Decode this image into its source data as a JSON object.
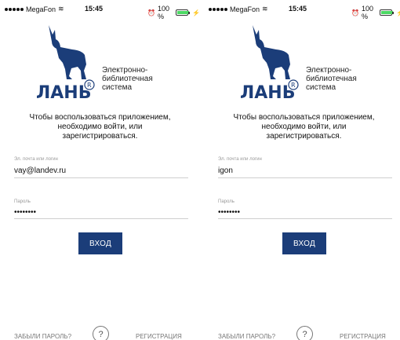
{
  "status": {
    "carrier": "MegaFon",
    "time": "15:45",
    "battery": "100 %",
    "battery_level": 1.0
  },
  "logo": {
    "brand": "ЛАНЬ",
    "tagline": [
      "Электронно-",
      "библиотечная",
      "система"
    ],
    "brand_color": "#1b3d79"
  },
  "intro": [
    "Чтобы воспользоваться приложением,",
    "необходимо войти, или",
    "зарегистрироваться."
  ],
  "screens": [
    {
      "email_label": "Эл. почта или логин",
      "email_value": "vay@landev.ru",
      "password_label": "Пароль",
      "password_value": "••••••••"
    },
    {
      "email_label": "Эл. почта или логин",
      "email_value": "igon",
      "password_label": "Пароль",
      "password_value": "••••••••"
    }
  ],
  "login_button": "ВХОД",
  "footer": {
    "forgot": "ЗАБЫЛИ ПАРОЛЬ?",
    "help": "?",
    "register": "РЕГИСТРАЦИЯ"
  },
  "colors": {
    "button": "#1b3d79",
    "battery": "#4cd964"
  }
}
